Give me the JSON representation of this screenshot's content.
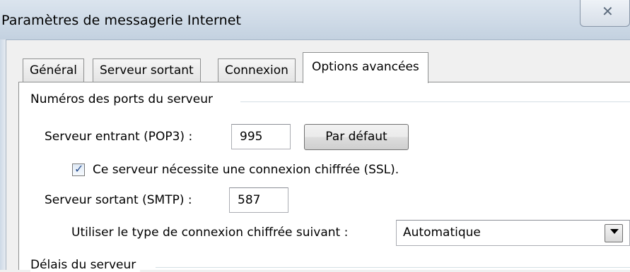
{
  "window": {
    "title": "Paramètres de messagerie Internet",
    "close_symbol": "✕",
    "close_icon": "close-icon"
  },
  "tabs": [
    {
      "label": "Général",
      "active": false
    },
    {
      "label": "Serveur sortant",
      "active": false
    },
    {
      "label": "Connexion",
      "active": false
    },
    {
      "label": "Options avancées",
      "active": true
    }
  ],
  "ports_group": {
    "title": "Numéros des ports du serveur",
    "incoming_label": "Serveur entrant (POP3) :",
    "incoming_value": "995",
    "default_button": "Par défaut",
    "ssl_checkbox_label": "Ce serveur nécessite une connexion chiffrée (SSL).",
    "ssl_checked": true,
    "outgoing_label": "Serveur sortant (SMTP) :",
    "outgoing_value": "587",
    "encryption_label": "Utiliser le type de connexion chiffrée suivant :",
    "encryption_value": "Automatique"
  },
  "timeouts_group": {
    "title": "Délais du serveur"
  },
  "colors": {
    "titlebar": "#cdd9e6",
    "checkmark": "#2a4f8f",
    "tab_border": "#8e8f8f"
  }
}
